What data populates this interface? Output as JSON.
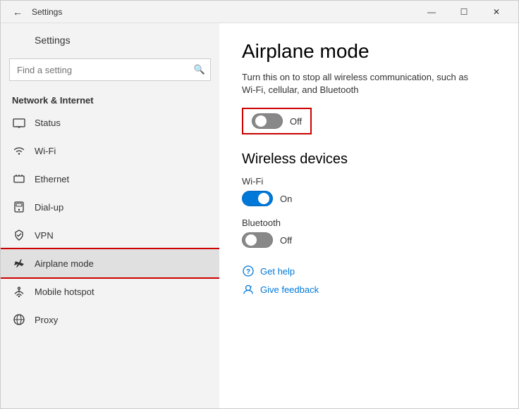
{
  "window": {
    "title": "Settings",
    "controls": {
      "minimize": "—",
      "maximize": "☐",
      "close": "✕"
    }
  },
  "sidebar": {
    "back_label": "←",
    "header": "Settings",
    "search_placeholder": "Find a setting",
    "search_icon": "🔍",
    "section_label": "Network & Internet",
    "items": [
      {
        "id": "status",
        "icon": "🖥",
        "label": "Status"
      },
      {
        "id": "wifi",
        "icon": "((·",
        "label": "Wi-Fi"
      },
      {
        "id": "ethernet",
        "icon": "🖧",
        "label": "Ethernet"
      },
      {
        "id": "dialup",
        "icon": "☎",
        "label": "Dial-up"
      },
      {
        "id": "vpn",
        "icon": "🔒",
        "label": "VPN"
      },
      {
        "id": "airplane",
        "icon": "✈",
        "label": "Airplane mode",
        "active": true
      },
      {
        "id": "hotspot",
        "icon": "📡",
        "label": "Mobile hotspot"
      },
      {
        "id": "proxy",
        "icon": "🌐",
        "label": "Proxy"
      }
    ]
  },
  "main": {
    "page_title": "Airplane mode",
    "page_description": "Turn this on to stop all wireless communication, such as Wi-Fi, cellular, and Bluetooth",
    "airplane_toggle": {
      "state": "off",
      "label": "Off"
    },
    "wireless_section_title": "Wireless devices",
    "wifi": {
      "label": "Wi-Fi",
      "state": "on",
      "state_label": "On"
    },
    "bluetooth": {
      "label": "Bluetooth",
      "state": "off",
      "state_label": "Off"
    },
    "links": {
      "get_help": "Get help",
      "give_feedback": "Give feedback"
    }
  },
  "icons": {
    "back": "←",
    "search": "🔍",
    "status": "⊞",
    "wifi": "wifi",
    "ethernet": "ethernet",
    "dialup": "dialup",
    "vpn": "vpn",
    "airplane": "✈",
    "hotspot": "hotspot",
    "proxy": "proxy",
    "get_help": "💬",
    "give_feedback": "👤"
  }
}
